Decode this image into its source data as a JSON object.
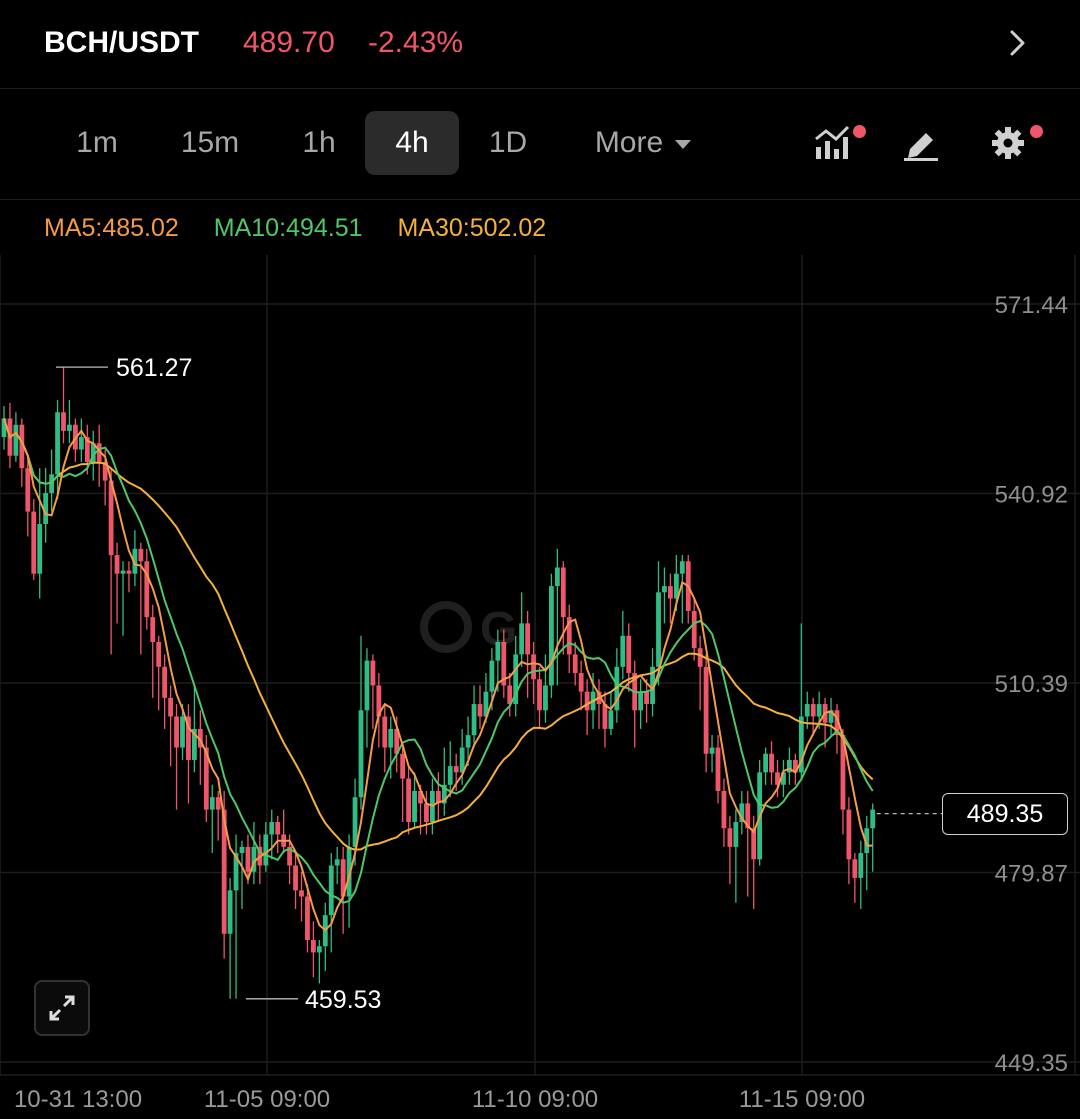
{
  "header": {
    "pair": "BCH/USDT",
    "price": "489.70",
    "change": "-2.43%"
  },
  "timeframes": [
    {
      "label": "1m",
      "active": false
    },
    {
      "label": "15m",
      "active": false
    },
    {
      "label": "1h",
      "active": false
    },
    {
      "label": "4h",
      "active": true
    },
    {
      "label": "1D",
      "active": false
    },
    {
      "label": "More",
      "active": false
    }
  ],
  "ma": {
    "ma5": "MA5:485.02",
    "ma10": "MA10:494.51",
    "ma30": "MA30:502.02"
  },
  "colors": {
    "up": "#2ebd85",
    "down": "#f0566a",
    "ma5": "#f49a4a",
    "ma10": "#4fc767",
    "ma30": "#f3b13c"
  },
  "chart_data": {
    "type": "candlestick",
    "price_axis": [
      "571.44",
      "540.92",
      "510.39",
      "479.87",
      "449.35"
    ],
    "time_axis": [
      "10-31 13:00",
      "11-05 09:00",
      "11-10 09:00",
      "11-15 09:00"
    ],
    "high_label": "561.27",
    "low_label": "459.53",
    "last_price": "489.35",
    "ylim": [
      449.35,
      571.44
    ],
    "candles": [
      [
        550.0,
        553.0,
        555.0,
        548.0
      ],
      [
        553.0,
        547.0,
        555.5,
        545.0
      ],
      [
        547.0,
        552.0,
        554.0,
        546.0
      ],
      [
        552.0,
        545.0,
        553.0,
        542.0
      ],
      [
        545.0,
        538.0,
        547.0,
        534.0
      ],
      [
        538.0,
        528.0,
        540.0,
        527.0
      ],
      [
        528.0,
        536.0,
        545.0,
        524.0
      ],
      [
        536.0,
        541.0,
        545.0,
        533.0
      ],
      [
        541.0,
        544.0,
        548.0,
        538.0
      ],
      [
        544.0,
        554.0,
        556.0,
        540.0
      ],
      [
        554.0,
        551.0,
        561.27,
        549.0
      ],
      [
        551.0,
        552.0,
        556.0,
        549.0
      ],
      [
        552.0,
        548.0,
        553.0,
        546.0
      ],
      [
        548.0,
        550.0,
        553.0,
        546.0
      ],
      [
        550.0,
        546.0,
        552.0,
        544.0
      ],
      [
        546.0,
        549.0,
        551.0,
        543.0
      ],
      [
        549.0,
        546.0,
        552.0,
        542.0
      ],
      [
        546.0,
        543.0,
        548.0,
        539.0
      ],
      [
        543.0,
        531.0,
        545.0,
        515.0
      ],
      [
        531.0,
        528.0,
        533.0,
        520.0
      ],
      [
        528.0,
        528.5,
        530.0,
        518.0
      ],
      [
        528.5,
        528.0,
        530.0,
        525.0
      ],
      [
        528.0,
        532.0,
        535.0,
        526.0
      ],
      [
        532.0,
        530.0,
        533.0,
        515.0
      ],
      [
        530.0,
        521.0,
        532.0,
        519.0
      ],
      [
        521.0,
        517.0,
        523.0,
        508.0
      ],
      [
        517.0,
        513.0,
        518.0,
        506.0
      ],
      [
        513.0,
        508.0,
        515.0,
        503.0
      ],
      [
        508.0,
        505.0,
        510.0,
        497.0
      ],
      [
        505.0,
        500.0,
        507.0,
        490.0
      ],
      [
        500.0,
        505.0,
        507.0,
        498.0
      ],
      [
        505.0,
        498.0,
        507.0,
        491.0
      ],
      [
        498.0,
        503.0,
        510.0,
        496.0
      ],
      [
        503.0,
        500.0,
        506.0,
        494.0
      ],
      [
        500.0,
        490.0,
        502.0,
        488.0
      ],
      [
        490.0,
        492.0,
        494.0,
        483.0
      ],
      [
        492.0,
        490.0,
        493.0,
        485.0
      ],
      [
        490.0,
        470.0,
        493.0,
        466.0
      ],
      [
        470.0,
        477.0,
        479.0,
        459.53
      ],
      [
        477.0,
        483.0,
        486.0,
        459.53
      ],
      [
        483.0,
        484.0,
        485.0,
        474.0
      ],
      [
        484.0,
        480.0,
        486.0,
        478.0
      ],
      [
        480.0,
        484.0,
        488.0,
        478.0
      ],
      [
        484.0,
        481.0,
        486.0,
        478.0
      ],
      [
        481.0,
        486.0,
        488.0,
        480.0
      ],
      [
        486.0,
        488.0,
        490.0,
        482.0
      ],
      [
        488.0,
        486.0,
        489.0,
        483.0
      ],
      [
        486.0,
        484.0,
        490.0,
        483.0
      ],
      [
        484.0,
        481.0,
        486.0,
        478.0
      ],
      [
        481.0,
        477.0,
        483.0,
        474.0
      ],
      [
        477.0,
        476.0,
        480.0,
        472.0
      ],
      [
        476.0,
        469.0,
        478.0,
        467.0
      ],
      [
        469.0,
        467.0,
        472.0,
        463.0
      ],
      [
        467.0,
        468.0,
        469.0,
        462.0
      ],
      [
        468.0,
        473.0,
        475.0,
        464.0
      ],
      [
        473.0,
        481.0,
        483.0,
        467.0
      ],
      [
        481.0,
        482.0,
        484.0,
        478.0
      ],
      [
        482.0,
        476.0,
        484.0,
        470.0
      ],
      [
        476.0,
        484.0,
        486.0,
        471.0
      ],
      [
        484.0,
        492.0,
        495.0,
        481.0
      ],
      [
        492.0,
        506.0,
        518.0,
        490.0
      ],
      [
        506.0,
        514.0,
        516.0,
        500.0
      ],
      [
        514.0,
        510.0,
        515.0,
        503.0
      ],
      [
        510.0,
        505.0,
        512.0,
        500.0
      ],
      [
        505.0,
        500.0,
        507.0,
        496.0
      ],
      [
        500.0,
        503.0,
        505.0,
        495.0
      ],
      [
        503.0,
        499.0,
        505.0,
        496.0
      ],
      [
        499.0,
        495.0,
        501.0,
        488.0
      ],
      [
        495.0,
        488.0,
        497.0,
        486.0
      ],
      [
        488.0,
        493.0,
        496.0,
        487.0
      ],
      [
        493.0,
        491.0,
        494.0,
        486.0
      ],
      [
        491.0,
        488.0,
        493.0,
        486.0
      ],
      [
        488.0,
        493.0,
        495.0,
        486.0
      ],
      [
        493.0,
        491.0,
        496.0,
        488.0
      ],
      [
        491.0,
        494.0,
        500.0,
        489.0
      ],
      [
        494.0,
        497.0,
        501.0,
        492.0
      ],
      [
        497.0,
        496.0,
        499.0,
        493.0
      ],
      [
        496.0,
        500.0,
        503.0,
        494.0
      ],
      [
        500.0,
        502.0,
        505.0,
        497.0
      ],
      [
        502.0,
        507.0,
        510.0,
        500.0
      ],
      [
        507.0,
        505.0,
        510.0,
        503.0
      ],
      [
        505.0,
        509.0,
        512.0,
        504.0
      ],
      [
        509.0,
        514.0,
        516.0,
        506.0
      ],
      [
        514.0,
        517.0,
        519.0,
        509.0
      ],
      [
        517.0,
        510.0,
        519.0,
        508.0
      ],
      [
        510.0,
        507.0,
        512.0,
        505.0
      ],
      [
        507.0,
        515.0,
        518.0,
        505.0
      ],
      [
        515.0,
        520.0,
        525.0,
        513.0
      ],
      [
        520.0,
        515.0,
        522.0,
        508.0
      ],
      [
        515.0,
        511.0,
        517.0,
        507.0
      ],
      [
        511.0,
        506.0,
        513.0,
        503.0
      ],
      [
        506.0,
        510.0,
        515.0,
        504.0
      ],
      [
        510.0,
        526.0,
        528.0,
        508.0
      ],
      [
        526.0,
        529.0,
        532.0,
        510.0
      ],
      [
        529.0,
        521.0,
        530.0,
        515.0
      ],
      [
        521.0,
        515.0,
        523.0,
        512.0
      ],
      [
        515.0,
        512.0,
        517.0,
        510.0
      ],
      [
        512.0,
        509.0,
        514.0,
        506.0
      ],
      [
        509.0,
        506.0,
        511.0,
        502.0
      ],
      [
        506.0,
        509.0,
        512.0,
        503.0
      ],
      [
        509.0,
        507.0,
        511.0,
        503.0
      ],
      [
        507.0,
        503.0,
        509.0,
        500.0
      ],
      [
        503.0,
        506.0,
        509.0,
        502.0
      ],
      [
        506.0,
        513.0,
        516.0,
        504.0
      ],
      [
        513.0,
        518.0,
        522.0,
        511.0
      ],
      [
        518.0,
        512.0,
        520.0,
        509.0
      ],
      [
        512.0,
        506.0,
        514.0,
        500.0
      ],
      [
        506.0,
        509.0,
        511.0,
        503.0
      ],
      [
        509.0,
        507.0,
        511.0,
        504.0
      ],
      [
        507.0,
        513.0,
        516.0,
        505.0
      ],
      [
        513.0,
        525.0,
        530.0,
        510.0
      ],
      [
        525.0,
        526.0,
        529.0,
        520.0
      ],
      [
        526.0,
        524.0,
        528.0,
        520.0
      ],
      [
        524.0,
        528.0,
        531.0,
        522.0
      ],
      [
        528.0,
        530.0,
        531.0,
        520.0
      ],
      [
        530.0,
        522.0,
        531.0,
        520.0
      ],
      [
        522.0,
        516.0,
        524.0,
        514.0
      ],
      [
        516.0,
        513.0,
        518.0,
        506.0
      ],
      [
        513.0,
        499.0,
        515.0,
        496.0
      ],
      [
        499.0,
        500.0,
        502.0,
        496.0
      ],
      [
        500.0,
        493.0,
        502.0,
        491.0
      ],
      [
        493.0,
        487.0,
        495.0,
        484.0
      ],
      [
        487.0,
        484.0,
        489.0,
        478.0
      ],
      [
        484.0,
        488.0,
        490.0,
        475.0
      ],
      [
        488.0,
        491.0,
        493.0,
        486.0
      ],
      [
        491.0,
        487.0,
        493.0,
        476.0
      ],
      [
        487.0,
        482.0,
        489.0,
        474.0
      ],
      [
        482.0,
        496.0,
        498.0,
        481.0
      ],
      [
        496.0,
        499.0,
        500.0,
        494.0
      ],
      [
        499.0,
        496.0,
        501.0,
        494.0
      ],
      [
        496.0,
        494.0,
        498.0,
        492.0
      ],
      [
        494.0,
        496.0,
        498.0,
        492.0
      ],
      [
        496.0,
        498.0,
        500.0,
        494.0
      ],
      [
        498.0,
        496.0,
        499.0,
        494.0
      ],
      [
        496.0,
        505.0,
        520.0,
        495.0
      ],
      [
        505.0,
        507.0,
        509.0,
        503.0
      ],
      [
        507.0,
        505.0,
        508.0,
        502.0
      ],
      [
        505.0,
        507.0,
        509.0,
        503.0
      ],
      [
        507.0,
        504.0,
        508.0,
        500.0
      ],
      [
        504.0,
        506.0,
        508.0,
        502.0
      ],
      [
        506.0,
        502.0,
        507.0,
        499.0
      ],
      [
        502.0,
        490.0,
        503.0,
        486.0
      ],
      [
        490.0,
        482.0,
        492.0,
        478.0
      ],
      [
        482.0,
        479.0,
        483.0,
        475.0
      ],
      [
        479.0,
        483.0,
        485.0,
        474.0
      ],
      [
        483.0,
        487.0,
        489.0,
        477.0
      ],
      [
        487.0,
        490.0,
        491.0,
        480.0
      ]
    ]
  }
}
